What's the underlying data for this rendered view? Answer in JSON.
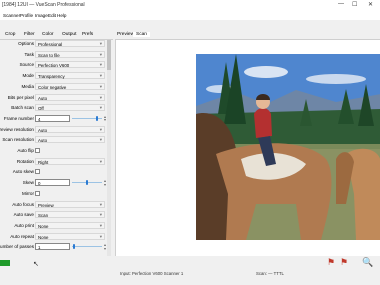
{
  "window": {
    "title": "[1984] 12UI — VueScan Professional",
    "minimize": "—",
    "maximize": "☐",
    "close": "✕"
  },
  "menu": [
    "Scanner",
    "Profile",
    "Image",
    "Edit",
    "Help"
  ],
  "left_tabs": [
    "Crop",
    "Filter",
    "Color",
    "Output",
    "Prefs"
  ],
  "right_tabs": [
    "Preview",
    "Scan"
  ],
  "settings": [
    {
      "label": "Options",
      "type": "select",
      "value": "Professional"
    },
    {
      "label": "Task",
      "type": "select",
      "value": "Scan to file"
    },
    {
      "label": "Source",
      "type": "select",
      "value": "Perfection V600"
    },
    {
      "label": "Mode",
      "type": "select",
      "value": "Transparency"
    },
    {
      "label": "Media",
      "type": "select",
      "value": "Color negative"
    },
    {
      "label": "Bits per pixel",
      "type": "select",
      "value": "Auto"
    },
    {
      "label": "Batch scan",
      "type": "select",
      "value": "Off"
    },
    {
      "label": "Frame number",
      "type": "number",
      "value": "4",
      "level": 0.85
    },
    {
      "label": "Preview resolution",
      "type": "select",
      "value": "Auto"
    },
    {
      "label": "Scan resolution",
      "type": "select",
      "value": "Auto"
    },
    {
      "label": "Auto flip",
      "type": "check",
      "value": ""
    },
    {
      "label": "Rotation",
      "type": "select",
      "value": "Right"
    },
    {
      "label": "Auto skew",
      "type": "check",
      "value": ""
    },
    {
      "label": "Skew",
      "type": "number",
      "value": "0",
      "level": 0.5
    },
    {
      "label": "Mirror",
      "type": "check",
      "value": ""
    },
    {
      "label": "Auto focus",
      "type": "select",
      "value": "Preview"
    },
    {
      "label": "Auto save",
      "type": "select",
      "value": "Scan"
    },
    {
      "label": "Auto print",
      "type": "select",
      "value": "None"
    },
    {
      "label": "Auto repeat",
      "type": "select",
      "value": "None"
    },
    {
      "label": "Number of passes",
      "type": "number",
      "value": "1",
      "level": 0.05
    }
  ],
  "status": {
    "device": "Input: Perfection V600 Scanner 1",
    "size": "Scan: — TTTL"
  },
  "icons": {
    "green_button": "green-button-icon",
    "pointer": "mouse-pointer-icon",
    "scan1": "scan-icon",
    "scan2": "scan-red-icon",
    "zoom": "zoom-icon"
  }
}
